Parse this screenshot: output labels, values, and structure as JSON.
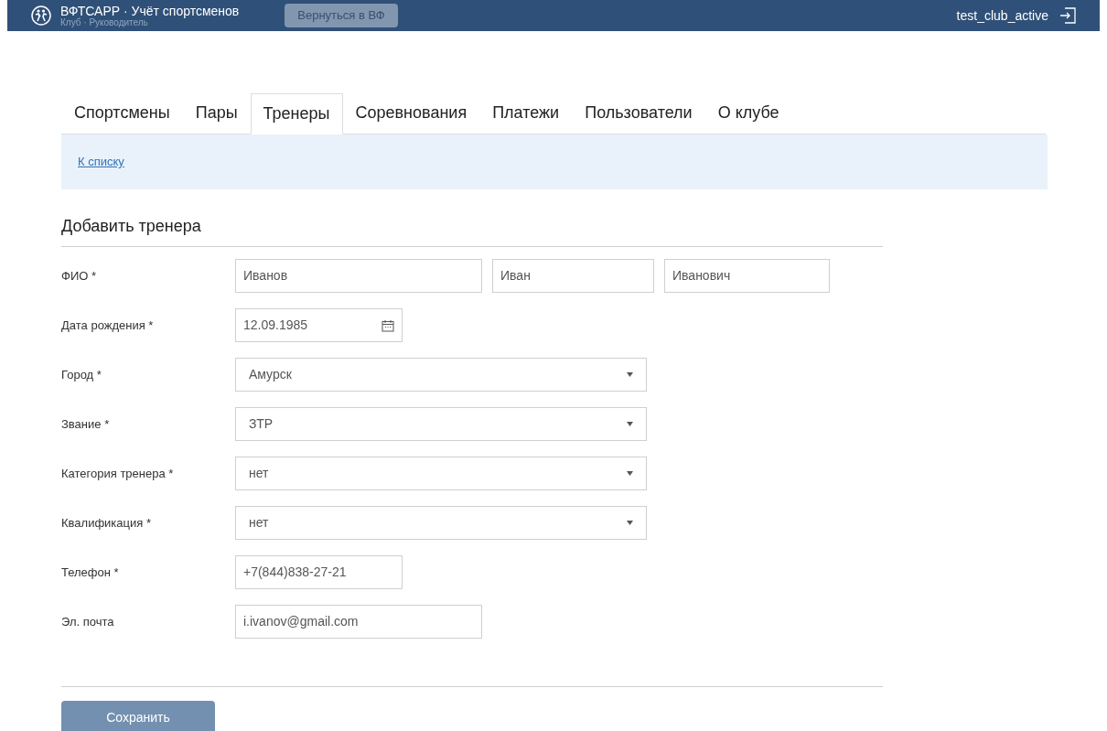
{
  "header": {
    "app_title": "ВФТСАРР · Учёт спортсменов",
    "subtitle": "Клуб · Руководитель",
    "back_button": "Вернуться в ВФ",
    "username": "test_club_active"
  },
  "tabs": [
    {
      "label": "Спортсмены",
      "selected": false
    },
    {
      "label": "Пары",
      "selected": false
    },
    {
      "label": "Тренеры",
      "selected": true
    },
    {
      "label": "Соревнования",
      "selected": false
    },
    {
      "label": "Платежи",
      "selected": false
    },
    {
      "label": "Пользователи",
      "selected": false
    },
    {
      "label": "О клубе",
      "selected": false
    }
  ],
  "back_link": "К списку",
  "form": {
    "title": "Добавить тренера",
    "fields": [
      {
        "label": "ФИО *",
        "kind": "name",
        "values": [
          "Иванов",
          "Иван",
          "Иванович"
        ]
      },
      {
        "label": "Дата рождения *",
        "kind": "date",
        "value": "12.09.1985"
      },
      {
        "label": "Город *",
        "kind": "select",
        "value": "Амурск"
      },
      {
        "label": "Звание *",
        "kind": "select",
        "value": "ЗТР"
      },
      {
        "label": "Категория тренера *",
        "kind": "select",
        "value": "нет"
      },
      {
        "label": "Квалификация *",
        "kind": "select",
        "value": "нет"
      },
      {
        "label": "Телефон *",
        "kind": "short",
        "value": "+7(844)838-27-21"
      },
      {
        "label": "Эл. почта",
        "kind": "text",
        "value": "i.ivanov@gmail.com"
      }
    ],
    "save_button": "Сохранить"
  }
}
